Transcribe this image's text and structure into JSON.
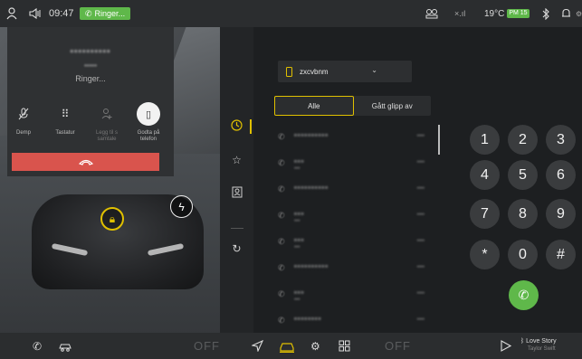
{
  "statusbar": {
    "time": "09:47",
    "ringer_pill": "Ringer...",
    "ringer_icon": "phone-icon",
    "temperature": "19°C",
    "temp_badge": "PM 15",
    "signal": "×.ıl",
    "icons": [
      "person-icon",
      "volume-icon",
      "car-status-icon",
      "signal-icon",
      "air-quality-icon",
      "bluetooth-icon",
      "bell-icon",
      "settings-icon"
    ]
  },
  "callcard": {
    "caller_name": "••••••••••",
    "caller_number": "•••••",
    "status": "Ringer...",
    "buttons": [
      {
        "label": "Demp",
        "icon": "mute-icon"
      },
      {
        "label": "Tastatur",
        "icon": "keypad-icon"
      },
      {
        "label": "Legg til s samtale",
        "icon": "add-call-icon"
      },
      {
        "label": "Godta på telefon",
        "icon": "phone-handset-icon"
      }
    ],
    "hangup_icon": "hangup-icon"
  },
  "phone": {
    "device_name": "zxcvbnm",
    "tabs": [
      {
        "label": "Alle",
        "active": true
      },
      {
        "label": "Gått glipp av",
        "active": false
      }
    ],
    "rail": [
      {
        "icon": "clock-icon",
        "active": true
      },
      {
        "icon": "star-icon",
        "active": false
      },
      {
        "icon": "contacts-icon",
        "active": false
      },
      {
        "icon": "refresh-icon",
        "active": false
      }
    ],
    "calls": [
      {
        "name": "••••••••••",
        "sub": "",
        "time": "••••"
      },
      {
        "name": "•••",
        "sub": "•••",
        "time": "••••"
      },
      {
        "name": "••••••••••",
        "sub": "",
        "time": "••••"
      },
      {
        "name": "•••",
        "sub": "•••",
        "time": "••••"
      },
      {
        "name": "•••",
        "sub": "•••",
        "time": "••••"
      },
      {
        "name": "••••••••••",
        "sub": "",
        "time": "••••"
      },
      {
        "name": "•••",
        "sub": "•••",
        "time": "••••"
      },
      {
        "name": "••••••••",
        "sub": "",
        "time": "••••"
      }
    ],
    "keypad": [
      "1",
      "2",
      "3",
      "4",
      "5",
      "6",
      "7",
      "8",
      "9",
      "*",
      "0",
      "#"
    ]
  },
  "bottombar": {
    "off_left": "OFF",
    "off_right": "OFF",
    "music_title": "Love Story",
    "music_artist": "Taylor Swift",
    "icons": [
      "phone-icon",
      "car-settings-icon",
      "navigation-icon",
      "car-icon",
      "gear-icon",
      "apps-icon",
      "play-icon",
      "bluetooth-icon"
    ]
  },
  "colors": {
    "accent": "#e0c000",
    "green": "#5fb84a",
    "hangup": "#d9544d"
  }
}
